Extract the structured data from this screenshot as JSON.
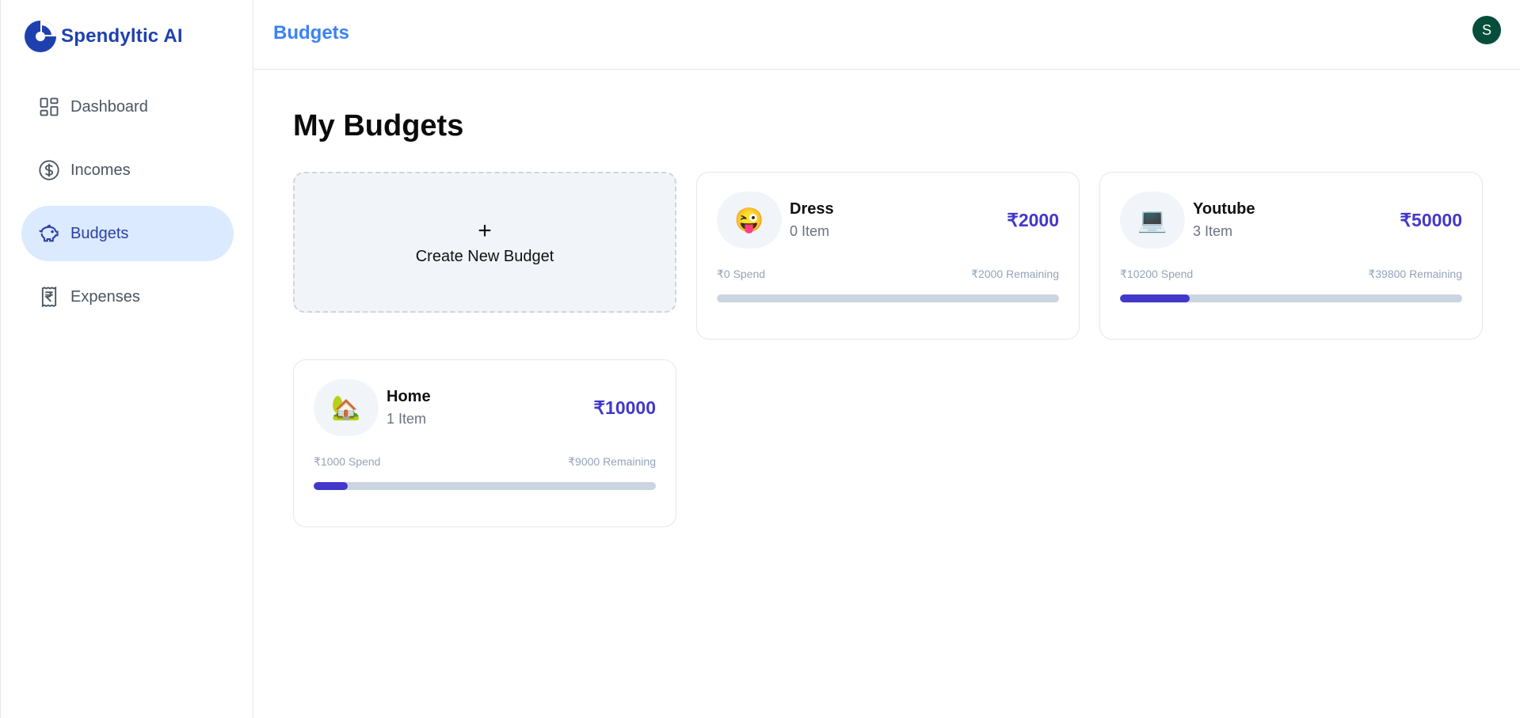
{
  "brand": {
    "name": "Spendyltic AI"
  },
  "sidebar": {
    "items": [
      {
        "label": "Dashboard",
        "icon": "dashboard-icon",
        "active": false
      },
      {
        "label": "Incomes",
        "icon": "dollar-circle-icon",
        "active": false
      },
      {
        "label": "Budgets",
        "icon": "piggy-bank-icon",
        "active": true
      },
      {
        "label": "Expenses",
        "icon": "receipt-rupee-icon",
        "active": false
      }
    ]
  },
  "header": {
    "title": "Budgets",
    "avatar_initial": "S"
  },
  "main": {
    "title": "My Budgets",
    "create": {
      "plus": "+",
      "label": "Create New Budget"
    },
    "budgets": [
      {
        "emoji": "😜",
        "name": "Dress",
        "items": "0 Item",
        "amount": "₹2000",
        "spend": "₹0 Spend",
        "remaining": "₹2000 Remaining",
        "progress": 0
      },
      {
        "emoji": "💻",
        "name": "Youtube",
        "items": "3 Item",
        "amount": "₹50000",
        "spend": "₹10200 Spend",
        "remaining": "₹39800 Remaining",
        "progress": 0.204
      },
      {
        "emoji": "🏡",
        "name": "Home",
        "items": "1 Item",
        "amount": "₹10000",
        "spend": "₹1000 Spend",
        "remaining": "₹9000 Remaining",
        "progress": 0.1
      }
    ]
  },
  "colors": {
    "brand": "#1e40af",
    "accent": "#4338ca",
    "header_title": "#3b82f6",
    "avatar": "#064e3b",
    "active_nav_bg": "#dbeafe"
  }
}
